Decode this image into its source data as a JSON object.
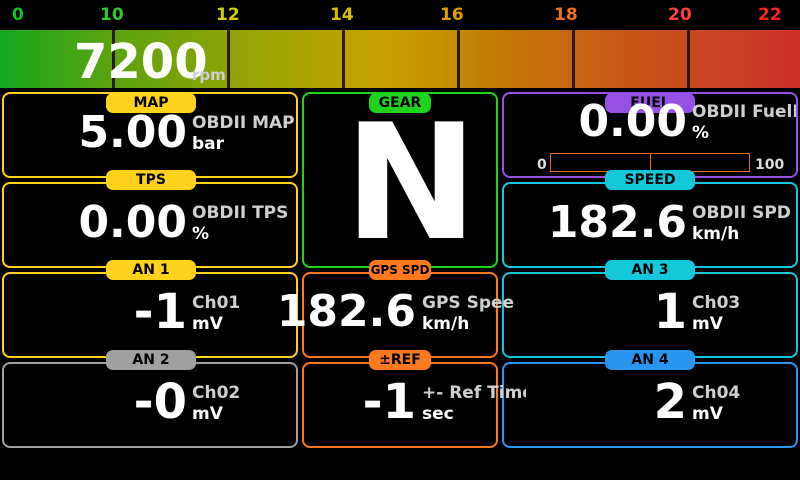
{
  "scale": {
    "labels": [
      "0",
      "10",
      "12",
      "14",
      "16",
      "18",
      "20",
      "22"
    ],
    "colors": [
      "#16c01a",
      "#2ecc2a",
      "#d0d000",
      "#d8c000",
      "#e0a000",
      "#f07020",
      "#ff4040",
      "#ff2020"
    ]
  },
  "rpm": {
    "value": "7200",
    "unit": "rpm"
  },
  "gear": {
    "tag": "GEAR",
    "value": "N"
  },
  "map": {
    "tag": "MAP",
    "value": "5.00",
    "name": "OBDII MAP",
    "unit": "bar"
  },
  "tps": {
    "tag": "TPS",
    "value": "0.00",
    "name": "OBDII TPS",
    "unit": "%"
  },
  "an1": {
    "tag": "AN 1",
    "value": "-1",
    "name": "Ch01",
    "unit": "mV"
  },
  "an2": {
    "tag": "AN 2",
    "value": "-0",
    "name": "Ch02",
    "unit": "mV"
  },
  "gps": {
    "tag": "GPS SPD",
    "value": "182.6",
    "name": "GPS Speed",
    "unit": "km/h"
  },
  "ref": {
    "tag": "±REF",
    "value": "-1",
    "name": "+- Ref Time",
    "unit": "sec"
  },
  "fuel": {
    "tag": "FUEL",
    "value": "0.00",
    "name": "OBDII FuelLe",
    "unit": "%",
    "min": "0",
    "max": "100"
  },
  "speed": {
    "tag": "SPEED",
    "value": "182.6",
    "name": "OBDII SPD",
    "unit": "km/h"
  },
  "an3": {
    "tag": "AN 3",
    "value": "1",
    "name": "Ch03",
    "unit": "mV"
  },
  "an4": {
    "tag": "AN 4",
    "value": "2",
    "name": "Ch04",
    "unit": "mV"
  },
  "colors": {
    "yellow": "#ffd21e",
    "green": "#1ed21e",
    "orange": "#ff7a1e",
    "purple": "#9650e6",
    "cyan": "#14c8dc",
    "gray": "#a0a0a0",
    "blue": "#2896f0"
  }
}
